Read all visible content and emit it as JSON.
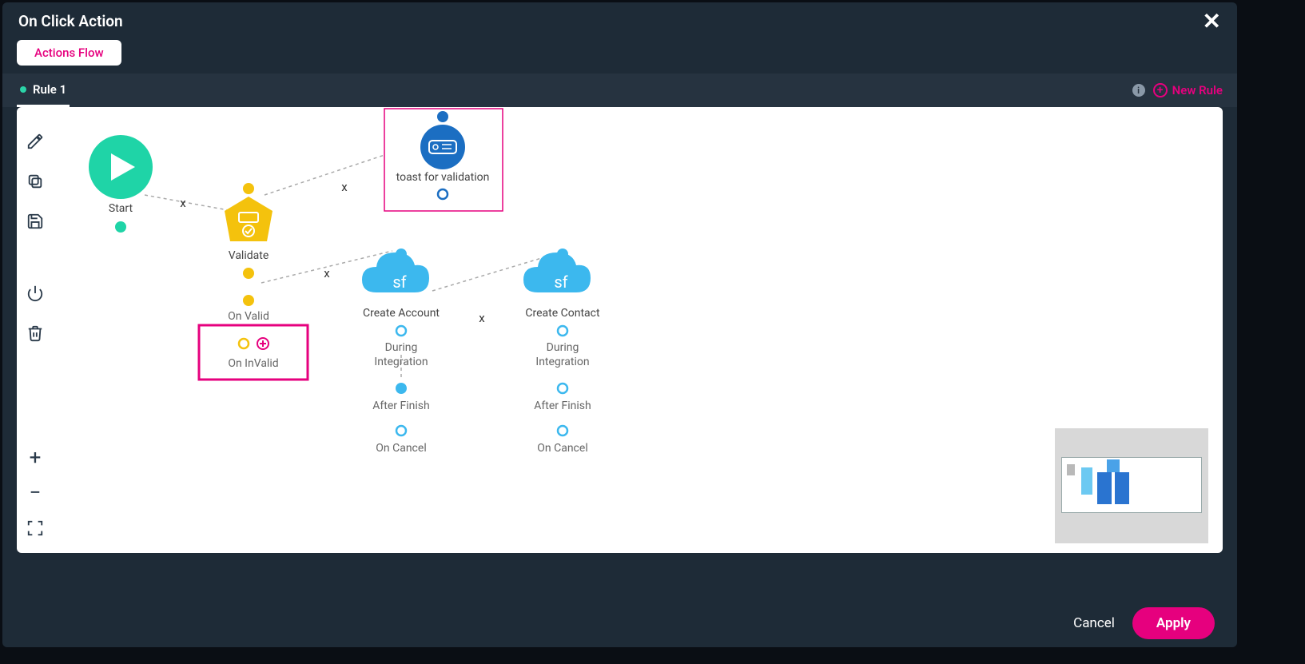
{
  "header": {
    "title": "On Click Action"
  },
  "pills": {
    "actions_flow": "Actions Flow"
  },
  "tabs": {
    "rule1": "Rule 1",
    "new_rule": "New Rule"
  },
  "nodes": {
    "start": "Start",
    "validate": "Validate",
    "on_valid": "On Valid",
    "on_invalid": "On InValid",
    "toast": "toast for validation",
    "create_account": "Create Account",
    "create_contact": "Create Contact",
    "during_integration": "During\nIntegration",
    "after_finish": "After Finish",
    "on_cancel": "On Cancel"
  },
  "footer": {
    "cancel": "Cancel",
    "apply": "Apply"
  }
}
